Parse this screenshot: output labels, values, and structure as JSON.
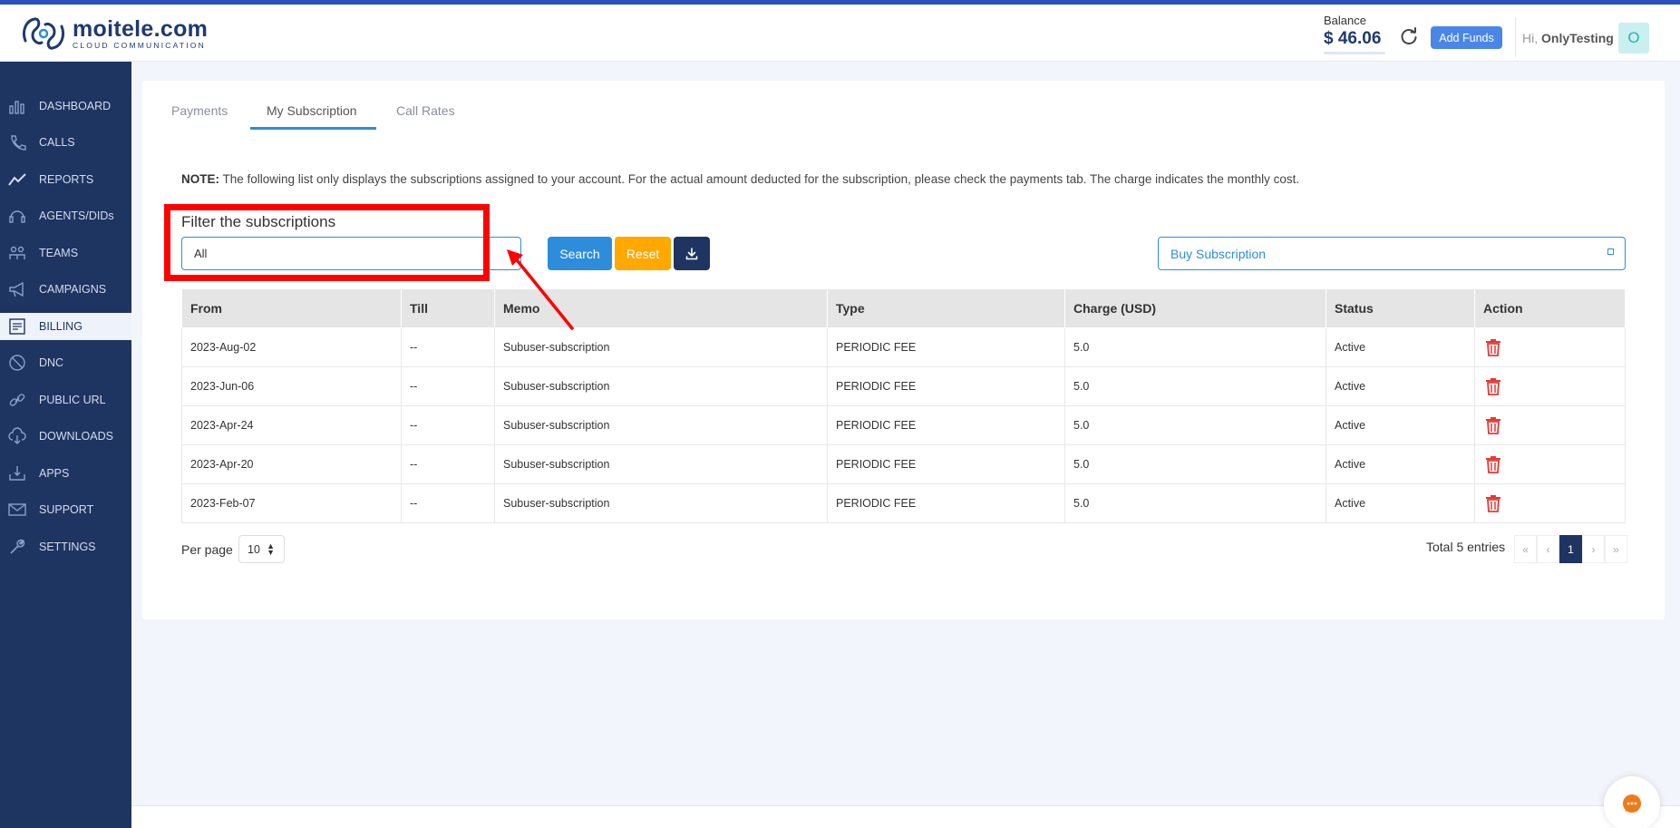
{
  "app": {
    "logo_main": "moitele.com",
    "logo_sub": "CLOUD COMMUNICATION"
  },
  "header": {
    "balance_label": "Balance",
    "balance_value": "$ 46.06",
    "add_funds_label": "Add Funds",
    "greeting_prefix": "Hi, ",
    "user_name": "OnlyTesting",
    "avatar_initial": "O"
  },
  "sidebar": {
    "items": [
      {
        "label": "DASHBOARD",
        "icon": "dashboard-icon"
      },
      {
        "label": "CALLS",
        "icon": "phone-icon"
      },
      {
        "label": "REPORTS",
        "icon": "chart-line-icon"
      },
      {
        "label": "AGENTS/DIDs",
        "icon": "headset-icon"
      },
      {
        "label": "TEAMS",
        "icon": "team-icon"
      },
      {
        "label": "CAMPAIGNS",
        "icon": "megaphone-icon"
      },
      {
        "label": "BILLING",
        "icon": "billing-icon"
      },
      {
        "label": "DNC",
        "icon": "block-icon"
      },
      {
        "label": "PUBLIC URL",
        "icon": "link-icon"
      },
      {
        "label": "DOWNLOADS",
        "icon": "cloud-download-icon"
      },
      {
        "label": "APPS",
        "icon": "apps-download-icon"
      },
      {
        "label": "SUPPORT",
        "icon": "mail-icon"
      },
      {
        "label": "SETTINGS",
        "icon": "wrench-icon"
      }
    ],
    "active_index": 6
  },
  "tabs": [
    {
      "label": "Payments"
    },
    {
      "label": "My Subscription"
    },
    {
      "label": "Call Rates"
    }
  ],
  "note": {
    "prefix": "NOTE:",
    "text": " The following list only displays the subscriptions assigned to your account. For the actual amount deducted for the subscription, please check the payments tab. The charge indicates the monthly cost."
  },
  "filter": {
    "label": "Filter the subscriptions",
    "value": "All",
    "search_label": "Search",
    "reset_label": "Reset",
    "buy_placeholder": "Buy Subscription"
  },
  "table": {
    "columns": [
      "From",
      "Till",
      "Memo",
      "Type",
      "Charge (USD)",
      "Status",
      "Action"
    ],
    "rows": [
      {
        "from": "2023-Aug-02",
        "till": "--",
        "memo": "Subuser-subscription",
        "type": "PERIODIC FEE",
        "charge": "5.0",
        "status": "Active"
      },
      {
        "from": "2023-Jun-06",
        "till": "--",
        "memo": "Subuser-subscription",
        "type": "PERIODIC FEE",
        "charge": "5.0",
        "status": "Active"
      },
      {
        "from": "2023-Apr-24",
        "till": "--",
        "memo": "Subuser-subscription",
        "type": "PERIODIC FEE",
        "charge": "5.0",
        "status": "Active"
      },
      {
        "from": "2023-Apr-20",
        "till": "--",
        "memo": "Subuser-subscription",
        "type": "PERIODIC FEE",
        "charge": "5.0",
        "status": "Active"
      },
      {
        "from": "2023-Feb-07",
        "till": "--",
        "memo": "Subuser-subscription",
        "type": "PERIODIC FEE",
        "charge": "5.0",
        "status": "Active"
      }
    ]
  },
  "pagination": {
    "per_page_label": "Per page",
    "per_page_value": "10",
    "total_text": "Total 5 entries",
    "first": "«",
    "prev": "‹",
    "current": "1",
    "next": "›",
    "last": "»"
  },
  "colors": {
    "sidebar_bg": "#1e3461",
    "accent_blue": "#2d8ddb",
    "reset_orange": "#ffa800",
    "delete_red": "#e53935",
    "highlight_red": "#ff0000"
  }
}
